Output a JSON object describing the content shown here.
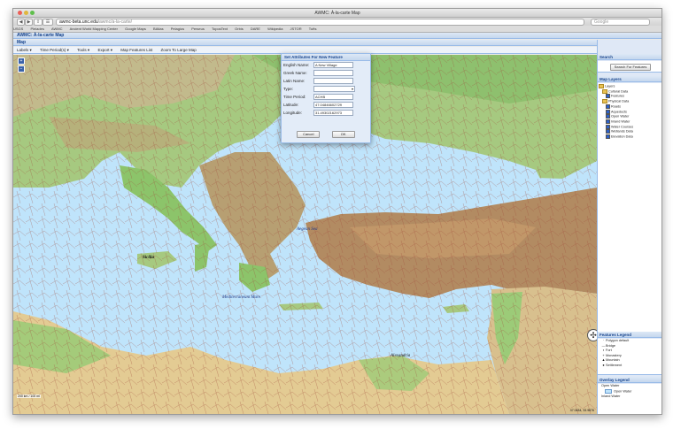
{
  "browser": {
    "window_title": "AWMC: À-la-carte Map",
    "url_host": "awmc-beta.unc.edu",
    "url_path": "/awmc/a-la-carte/",
    "search_placeholder": "Google",
    "bookmarks": [
      "USGS",
      "Pleiades",
      "AWMC",
      "Ancient World Mapping Center",
      "Google Maps",
      "BAtlas",
      "Pelagios",
      "Perseus",
      "ToposText",
      "Orbis",
      "DARE",
      "Wikipedia",
      "JSTOR",
      "Tufts"
    ]
  },
  "app": {
    "title": "AWMC: À-la-carte Map",
    "map_panel_title": "Map",
    "toolbar": [
      "Labels ▾",
      "Time Period(s) ▾",
      "Tools ▾",
      "Export ▾",
      "Map Features List",
      "Zoom To Large Map"
    ]
  },
  "map": {
    "labels": {
      "aegean": "Aegean Sea",
      "mediterranean": "Mediterraneum Mare",
      "sicily": "Sicilia",
      "alexandria": "Alexandria"
    },
    "zoom_in": "+",
    "zoom_out": "−",
    "scale": "200 km / 100 mi",
    "coordinates": "47.0484, 33.9876"
  },
  "dialog": {
    "title": "Set Attributes For New Feature",
    "fields": [
      {
        "label": "English Name:",
        "value": "A New Village"
      },
      {
        "label": "Greek Name:",
        "value": ""
      },
      {
        "label": "Latin Name:",
        "value": ""
      },
      {
        "label": "Type:",
        "value": ""
      },
      {
        "label": "Time Period:",
        "value": "ACHB"
      },
      {
        "label": "Latitude:",
        "value": "47.04846602729"
      },
      {
        "label": "Longitude:",
        "value": "31.49302162973"
      }
    ],
    "cancel": "Cancel",
    "ok": "OK"
  },
  "sidebar": {
    "search_title": "Search",
    "search_button": "Search For Features",
    "layers_title": "Map Layers",
    "layers": [
      {
        "label": "Layers",
        "kind": "folder",
        "indent": 0
      },
      {
        "label": "Cultural Data",
        "kind": "folder",
        "indent": 1
      },
      {
        "label": "Features",
        "kind": "check",
        "indent": 2,
        "checked": true
      },
      {
        "label": "Physical Data",
        "kind": "folder",
        "indent": 1
      },
      {
        "label": "Roads",
        "kind": "check",
        "indent": 2,
        "checked": true
      },
      {
        "label": "Aqueducts",
        "kind": "check",
        "indent": 2,
        "checked": true
      },
      {
        "label": "Open Water",
        "kind": "check",
        "indent": 2,
        "checked": true
      },
      {
        "label": "Inland Water",
        "kind": "check",
        "indent": 2,
        "checked": true
      },
      {
        "label": "Water Courses",
        "kind": "check",
        "indent": 2,
        "checked": true
      },
      {
        "label": "Wetlands Data",
        "kind": "check",
        "indent": 2,
        "checked": true
      },
      {
        "label": "Elevation Data",
        "kind": "check",
        "indent": 2,
        "checked": true
      }
    ],
    "features_legend_title": "Features Legend",
    "features_legend": [
      {
        "symbol": "·",
        "label": "Polygon default"
      },
      {
        "symbol": "—",
        "label": "Bridge"
      },
      {
        "symbol": "▪",
        "label": "Fort"
      },
      {
        "symbol": "+",
        "label": "Monastery"
      },
      {
        "symbol": "▲",
        "label": "Mountain"
      },
      {
        "symbol": "●",
        "label": "Settlement"
      }
    ],
    "overlay_legend_title": "Overlay Legend",
    "overlay_legend": [
      "Open Water",
      "Open Water",
      "Inland Water"
    ]
  },
  "colors": {
    "sea": "#bfe4fb",
    "panel_blue": "#99bbe8",
    "header_text": "#15428b"
  }
}
